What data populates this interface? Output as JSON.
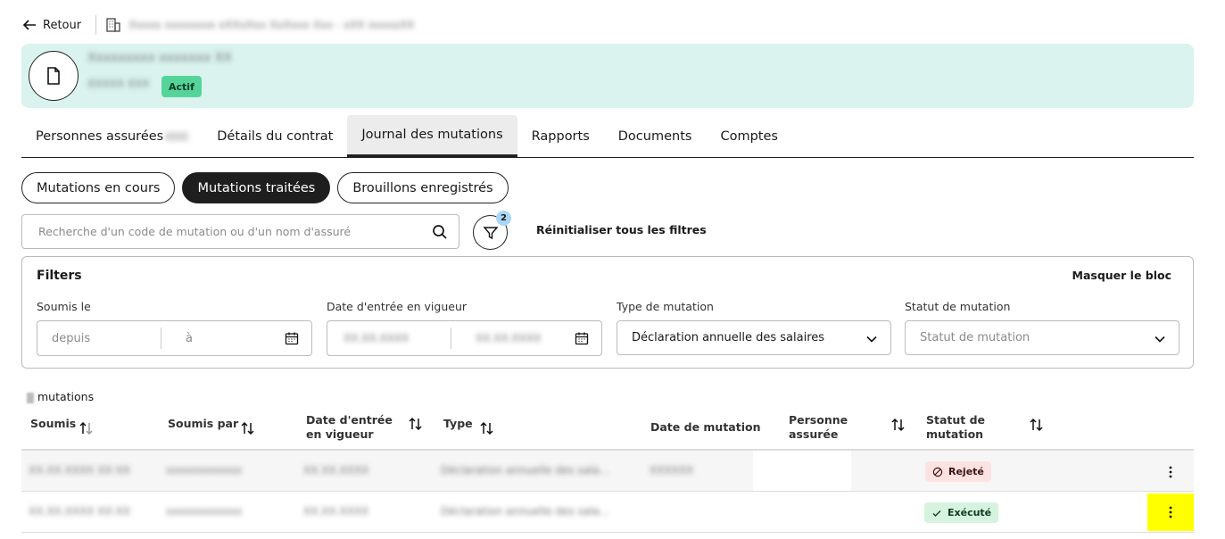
{
  "top": {
    "back_label": "Retour",
    "breadcrumb": "Xxxxx xxxxxxxx xXXxXxx XxXxxx Xxx - xXX xxxxxXX"
  },
  "header": {
    "title": "Xxxxxxxxx xxxxxxx XX",
    "subtitle": "XXXXX XXX",
    "status_badge": "Actif"
  },
  "tabs": [
    {
      "label": "Personnes assurées"
    },
    {
      "label": "Détails du contrat"
    },
    {
      "label": "Journal des mutations"
    },
    {
      "label": "Rapports"
    },
    {
      "label": "Documents"
    },
    {
      "label": "Comptes"
    }
  ],
  "pills": [
    {
      "label": "Mutations en cours"
    },
    {
      "label": "Mutations traitées"
    },
    {
      "label": "Brouillons enregistrés"
    }
  ],
  "search": {
    "placeholder": "Recherche d'un code de mutation ou d'un nom d'assuré",
    "filter_count": "2",
    "reset_label": "Réinitialiser tous les filtres"
  },
  "filters": {
    "title": "Filters",
    "hide_label": "Masquer le bloc",
    "soumis_le": {
      "label": "Soumis le",
      "from_placeholder": "depuis",
      "to_placeholder": "à"
    },
    "date_entree": {
      "label": "Date d'entrée en vigueur",
      "from_value": "XX.XX.XXXX",
      "to_value": "XX.XX.XXXX"
    },
    "type_mutation": {
      "label": "Type de mutation",
      "value": "Déclaration annuelle des salaires"
    },
    "statut_mutation": {
      "label": "Statut de mutation",
      "placeholder": "Statut de mutation"
    }
  },
  "table": {
    "count_suffix": "mutations",
    "headers": {
      "soumis": "Soumis",
      "soumis_par": "Soumis par",
      "date_entree": "Date d'entrée en vigueur",
      "type": "Type",
      "date_mutation": "Date de mutation",
      "personne": "Personne assurée",
      "statut": "Statut de mutation"
    },
    "rows": [
      {
        "soumis": "XX.XX.XXXX XX:XX",
        "soumis_par": "xxxxxxxxxxxx",
        "date_entree": "XX.XX.XXXX",
        "type": "Déclaration annuelle des sala...",
        "date_mutation": "XXXXXX",
        "statut": "Rejeté"
      },
      {
        "soumis": "XX.XX.XXXX XX:XX",
        "soumis_par": "xxxxxxxxxxxx",
        "date_entree": "XX.XX.XXXX",
        "type": "Déclaration annuelle des sala...",
        "date_mutation": "",
        "statut": "Exécuté"
      }
    ]
  },
  "colors": {
    "accent_bg": "#daf3ef",
    "active_badge": "#55d49a",
    "rejected_bg": "#fde2e2",
    "executed_bg": "#d6f3df",
    "highlight": "#ffff00"
  }
}
